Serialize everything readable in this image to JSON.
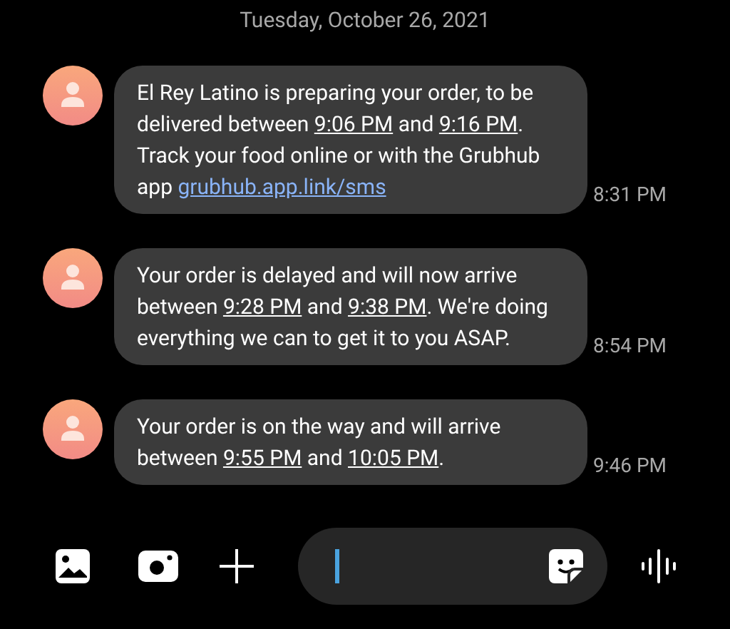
{
  "date_header": "Tuesday, October 26, 2021",
  "messages": [
    {
      "time": "8:31 PM",
      "parts": [
        {
          "kind": "plain",
          "text": "El Rey Latino is preparing your order, to be delivered between "
        },
        {
          "kind": "time",
          "text": "9:06 PM"
        },
        {
          "kind": "plain",
          "text": " and "
        },
        {
          "kind": "time",
          "text": "9:16 PM"
        },
        {
          "kind": "plain",
          "text": ". Track your food online or with the Grubhub app "
        },
        {
          "kind": "url",
          "text": "grubhub.app.link/sms"
        }
      ]
    },
    {
      "time": "8:54 PM",
      "parts": [
        {
          "kind": "plain",
          "text": "Your order is delayed and will now arrive between "
        },
        {
          "kind": "time",
          "text": "9:28 PM"
        },
        {
          "kind": "plain",
          "text": " and "
        },
        {
          "kind": "time",
          "text": "9:38 PM"
        },
        {
          "kind": "plain",
          "text": ". We're doing everything we can to get it to you ASAP."
        }
      ]
    },
    {
      "time": "9:46 PM",
      "parts": [
        {
          "kind": "plain",
          "text": "Your order is on the way and will arrive between "
        },
        {
          "kind": "time",
          "text": "9:55 PM"
        },
        {
          "kind": "plain",
          "text": " and "
        },
        {
          "kind": "time",
          "text": "10:05 PM"
        },
        {
          "kind": "plain",
          "text": "."
        }
      ]
    }
  ]
}
